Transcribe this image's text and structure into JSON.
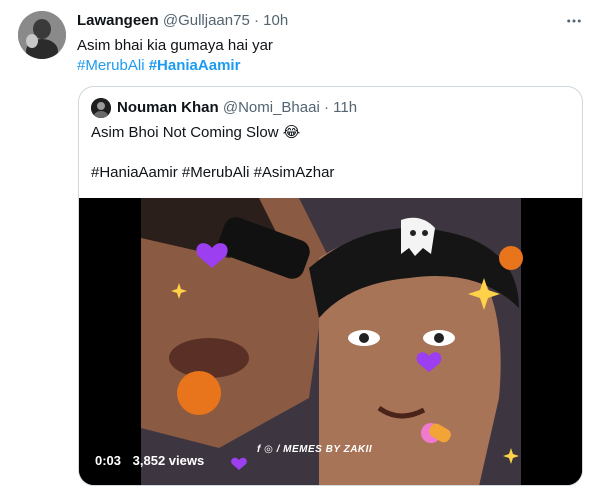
{
  "tweet": {
    "author_name": "Lawangeen",
    "author_handle": "@Gulljaan75",
    "separator": "·",
    "time": "10h",
    "text": "Asim bhai kia gumaya hai yar",
    "hashtags": [
      "#MerubAli",
      "#HaniaAamir"
    ]
  },
  "quote": {
    "author_name": "Nouman Khan",
    "author_handle": "@Nomi_Bhaai",
    "separator": "·",
    "time": "11h",
    "text": "Asim Bhoi Not Coming Slow 😂",
    "hashtags": "#HaniaAamir #MerubAli #AsimAzhar"
  },
  "video": {
    "timestamp": "0:03",
    "views": "3,852 views",
    "watermark": "f ◎ / MEMES BY ZAKII"
  },
  "colors": {
    "link": "#1d9bf0",
    "secondary": "#536471",
    "border": "#cfd9de"
  },
  "icons": {
    "more": "more-icon",
    "ghost": "ghost-emoji",
    "heart": "purple-heart",
    "pumpkin": "pumpkin-emoji"
  }
}
